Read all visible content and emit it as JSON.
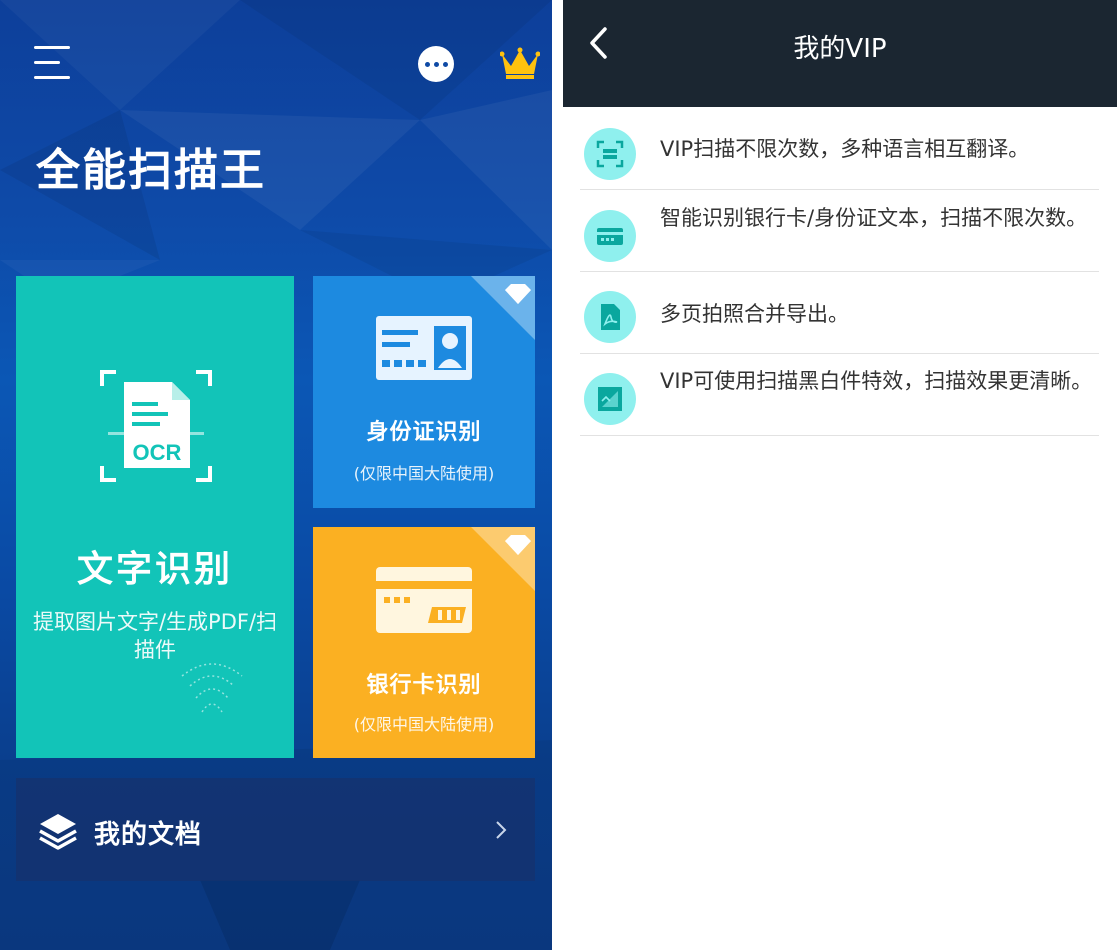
{
  "left_screen": {
    "app_title": "全能扫描王",
    "icons": {
      "menu": "menu-icon",
      "more": "more-icon",
      "vip": "crown-icon"
    },
    "cards": {
      "ocr": {
        "badge_text": "OCR",
        "title": "文字识别",
        "subtitle": "提取图片文字/生成PDF/扫描件",
        "color": "#12c4b8"
      },
      "id_card": {
        "title": "身份证识别",
        "subtitle": "(仅限中国大陆使用)",
        "color": "#1d8ae0",
        "premium_icon": "diamond-icon"
      },
      "bank_card": {
        "title": "银行卡识别",
        "subtitle": "(仅限中国大陆使用)",
        "color": "#fbb022",
        "premium_icon": "diamond-icon"
      }
    },
    "my_documents": {
      "label": "我的文档",
      "icon": "layers-icon"
    }
  },
  "right_screen": {
    "topbar": {
      "title": "我的VIP",
      "back_icon": "back-arrow-icon"
    },
    "vip_features": [
      {
        "icon": "scan-icon",
        "text": "VIP扫描不限次数，多种语言相互翻译。"
      },
      {
        "icon": "bank-card-icon",
        "text": "智能识别银行卡/身份证文本，扫描不限次数。"
      },
      {
        "icon": "pdf-icon",
        "text": "多页拍照合并导出。"
      },
      {
        "icon": "image-filter-icon",
        "text": "VIP可使用扫描黑白件特效，扫描效果更清晰。"
      }
    ]
  },
  "colors": {
    "teal": "#12c4b8",
    "blue": "#1d8ae0",
    "amber": "#fbb022",
    "dark_header": "#1b2631",
    "vip_icon_bg": "#8ff0ee"
  }
}
